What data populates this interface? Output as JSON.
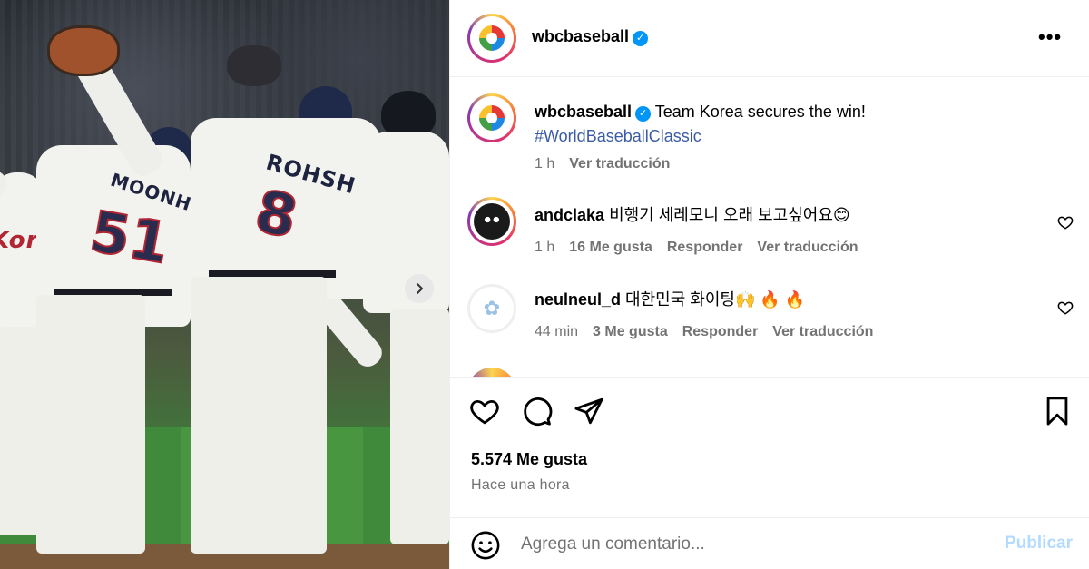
{
  "post": {
    "author": "wbcbaseball",
    "verified": true,
    "more_icon": "more-horizontal-icon"
  },
  "photo": {
    "players": [
      {
        "name": "MOONHB",
        "number": "51"
      },
      {
        "name": "ROHSH",
        "number": "8"
      }
    ],
    "jersey_letters": "Kor",
    "next_icon": "chevron-right-icon"
  },
  "caption": {
    "author": "wbcbaseball",
    "text": "Team Korea secures the win!",
    "hashtag": "#WorldBaseballClassic",
    "time": "1 h",
    "translate": "Ver traducción"
  },
  "comments": [
    {
      "author": "andclaka",
      "text": "비행기 세레모니 오래 보고싶어요😊",
      "time": "1 h",
      "likes": "16 Me gusta",
      "reply": "Responder",
      "translate": "Ver traducción"
    },
    {
      "author": "neulneul_d",
      "text": "대한민국 화이팅🙌 🔥 🔥",
      "time": "44 min",
      "likes": "3 Me gusta",
      "reply": "Responder",
      "translate": "Ver traducción"
    }
  ],
  "actions": {
    "like_count": "5.574 Me gusta",
    "time_ago": "Hace una hora"
  },
  "comment_box": {
    "placeholder": "Agrega un comentario...",
    "publish": "Publicar"
  },
  "colors": {
    "link": "#3b5ba5",
    "verified": "#0095f6",
    "muted": "#737373",
    "publish_disabled": "#b3dbff"
  }
}
